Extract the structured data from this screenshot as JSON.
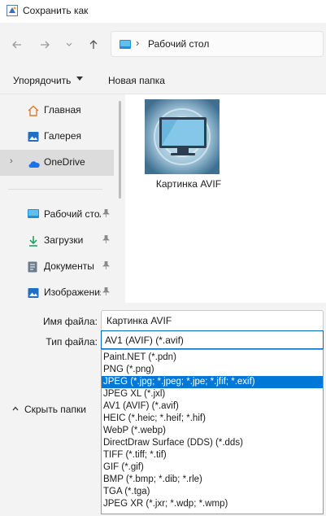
{
  "window": {
    "title": "Сохранить как"
  },
  "nav": {
    "back_icon": "arrow-left-icon",
    "forward_icon": "arrow-right-icon",
    "recent_icon": "chevron-down-icon",
    "up_icon": "arrow-up-icon"
  },
  "address": {
    "separator": "›",
    "location": "Рабочий стол"
  },
  "toolbar": {
    "organize_label": "Упорядочить",
    "new_folder_label": "Новая папка"
  },
  "sidebar": {
    "items": [
      {
        "label": "Главная",
        "icon": "home-icon"
      },
      {
        "label": "Галерея",
        "icon": "gallery-icon"
      },
      {
        "label": "OneDrive",
        "icon": "cloud-icon",
        "expander": "›"
      },
      {
        "label": "Рабочий стол",
        "icon": "desktop-icon",
        "pinned": true
      },
      {
        "label": "Загрузки",
        "icon": "download-icon",
        "pinned": true
      },
      {
        "label": "Документы",
        "icon": "documents-icon",
        "pinned": true
      },
      {
        "label": "Изображения",
        "icon": "pictures-icon",
        "pinned": true
      }
    ],
    "pin_glyph": "📌"
  },
  "content": {
    "files": [
      {
        "name": "Картинка AVIF",
        "icon": "avif-image-icon"
      }
    ]
  },
  "form": {
    "filename_label": "Имя файла:",
    "filename_value": "Картинка AVIF",
    "filetype_label": "Тип файла:",
    "filetype_selected": "AV1 (AVIF) (*.avif)",
    "filetype_options": [
      "Paint.NET (*.pdn)",
      "PNG (*.png)",
      "JPEG (*.jpg; *.jpeg; *.jpe; *.jfif; *.exif)",
      "JPEG XL (*.jxl)",
      "AV1 (AVIF) (*.avif)",
      "HEIC (*.heic; *.heif; *.hif)",
      "WebP (*.webp)",
      "DirectDraw Surface (DDS) (*.dds)",
      "TIFF (*.tiff; *.tif)",
      "GIF (*.gif)",
      "BMP (*.bmp; *.dib; *.rle)",
      "TGA (*.tga)",
      "JPEG XR (*.jxr; *.wdp; *.wmp)"
    ],
    "highlighted_option": "JPEG (*.jpg; *.jpeg; *.jpe; *.jfif; *.exif)"
  },
  "footer": {
    "hide_folders_label": "Скрыть папки",
    "hide_folders_icon": "chevron-up-icon"
  },
  "colors": {
    "accent": "#0078d7",
    "selection": "#0078d7",
    "window_bg": "#f3f3f3"
  }
}
